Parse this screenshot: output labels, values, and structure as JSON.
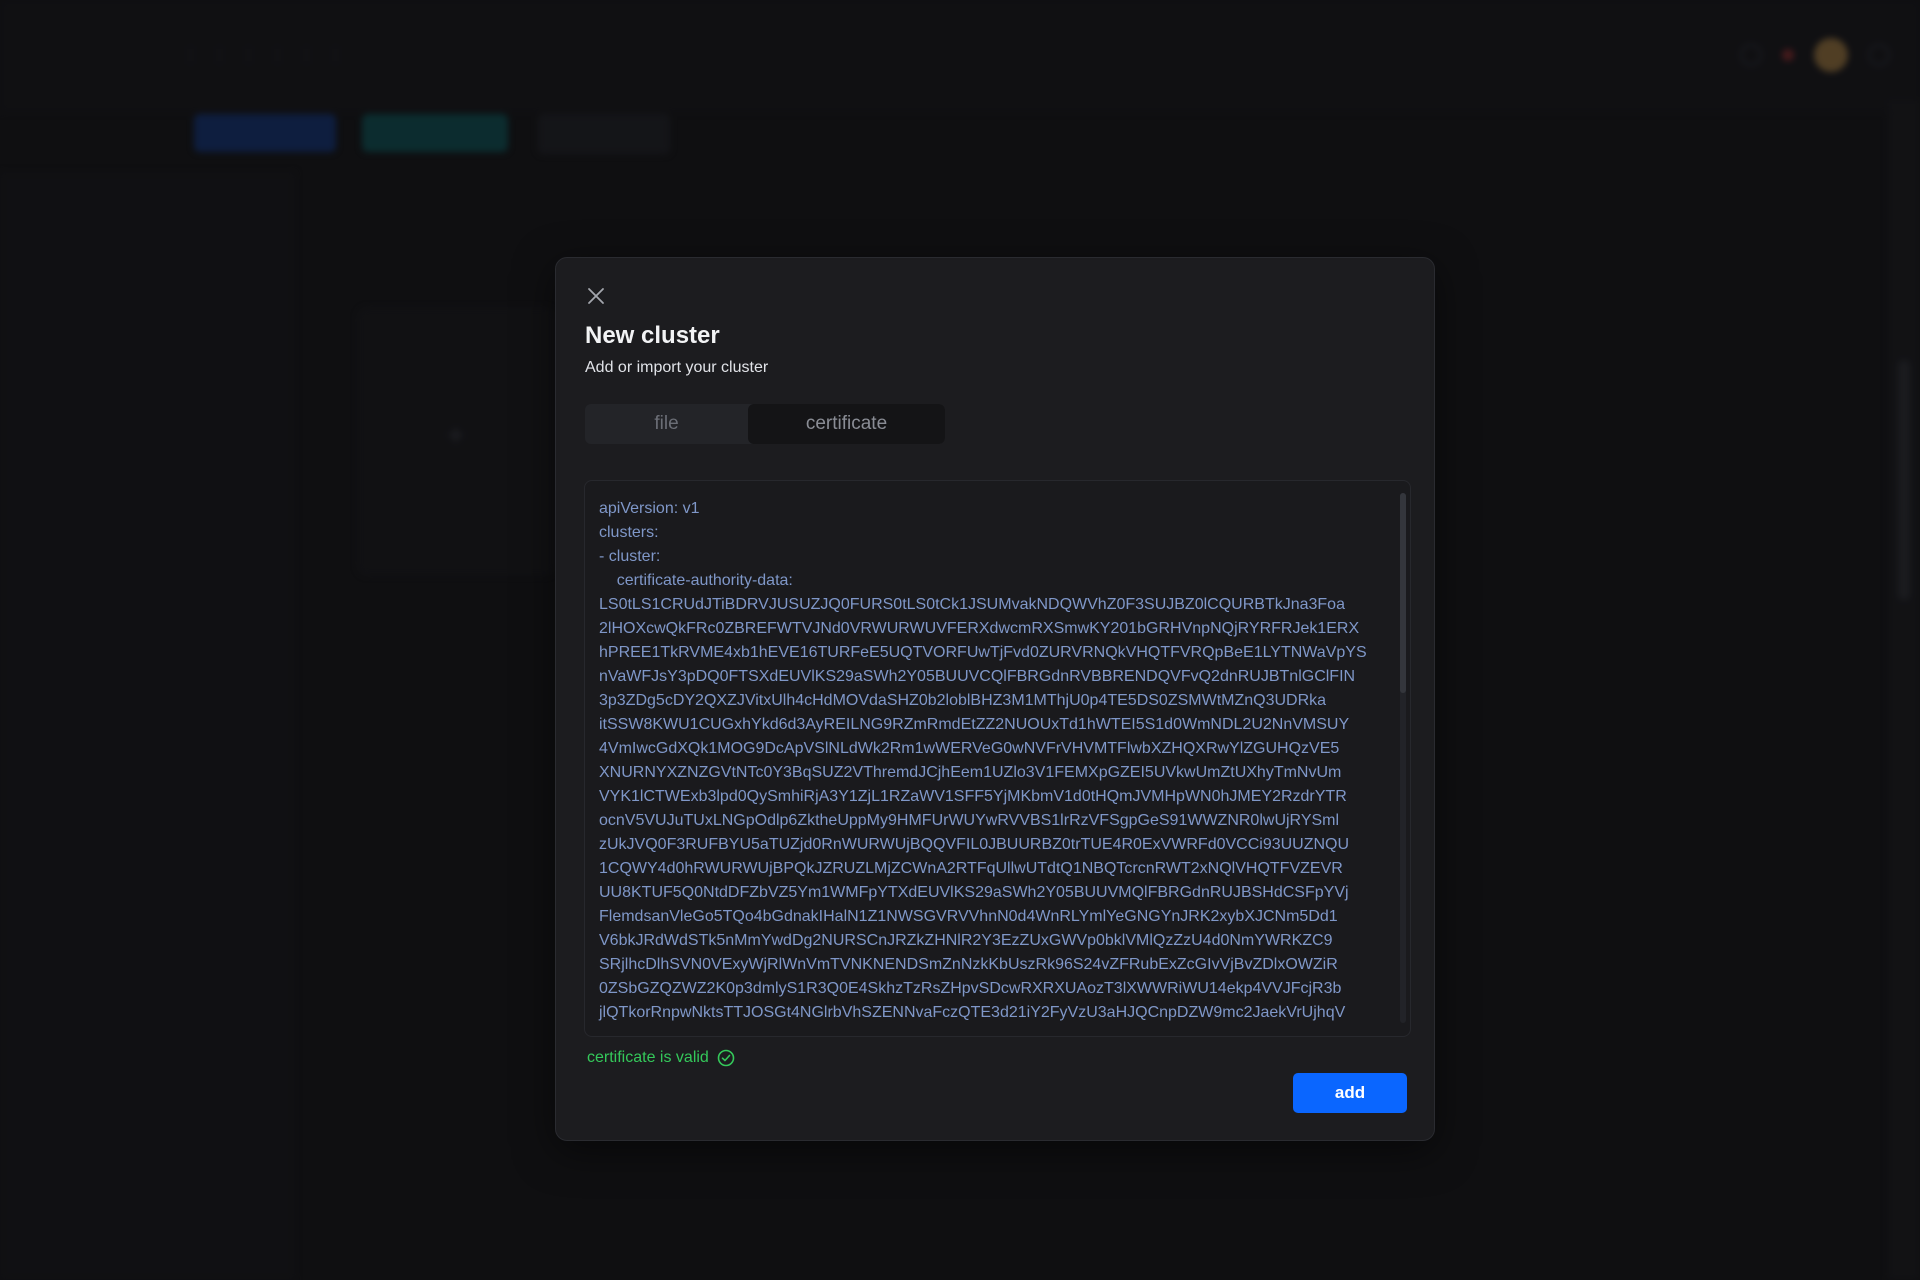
{
  "modal": {
    "title": "New cluster",
    "subtitle": "Add or import your cluster",
    "tabs": [
      {
        "label": "file",
        "active": false
      },
      {
        "label": "certificate",
        "active": true
      }
    ],
    "editor": {
      "lines": [
        "apiVersion: v1",
        "clusters:",
        "- cluster:",
        "    certificate-authority-data:",
        "LS0tLS1CRUdJTiBDRVJUSUZJQ0FURS0tLS0tCk1JSUMvakNDQWVhZ0F3SUJBZ0lCQURBTkJna3Foa",
        "2lHOXcwQkFRc0ZBREFWTVJNd0VRWURWUVFERXdwcmRXSmwKY201bGRHVnpNQjRYRFRJek1ERX",
        "hPREE1TkRVME4xb1hEVE16TURFeE5UQTVORFUwTjFvd0ZURVRNQkVHQTFVRQpBeE1LYTNWaVpYS",
        "nVaWFJsY3pDQ0FTSXdEUVlKS29aSWh2Y05BUUVCQlFBRGdnRVBBRENDQVFvQ2dnRUJBTnlGClFIN",
        "3p3ZDg5cDY2QXZJVitxUlh4cHdMOVdaSHZ0b2loblBHZ3M1MThjU0p4TE5DS0ZSMWtMZnQ3UDRka",
        "itSSW8KWU1CUGxhYkd6d3AyREILNG9RZmRmdEtZZ2NUOUxTd1hWTEI5S1d0WmNDL2U2NnVMSUY",
        "4VmIwcGdXQk1MOG9DcApVSlNLdWk2Rm1wWERVeG0wNVFrVHVMTFlwbXZHQXRwYlZGUHQzVE5",
        "XNURNYXZNZGVtNTc0Y3BqSUZ2VThremdJCjhEem1UZlo3V1FEMXpGZEI5UVkwUmZtUXhyTmNvUm",
        "VYK1lCTWExb3lpd0QySmhiRjA3Y1ZjL1RZaWV1SFF5YjMKbmV1d0tHQmJVMHpWN0hJMEY2RzdrYTR",
        "ocnV5VUJuTUxLNGpOdlp6ZktheUppMy9HMFUrWUYwRVVBS1lrRzVFSgpGeS91WWZNR0lwUjRYSml",
        "zUkJVQ0F3RUFBYU5aTUZjd0RnWURWUjBQQVFIL0JBUURBZ0trTUE4R0ExVWRFd0VCCi93UUZNQU",
        "1CQWY4d0hRWURWUjBPQkJZRUZLMjZCWnA2RTFqUllwUTdtQ1NBQTcrcnRWT2xNQlVHQTFVZEVR",
        "UU8KTUF5Q0NtdDFZbVZ5Ym1WMFpYTXdEUVlKS29aSWh2Y05BUUVMQlFBRGdnRUJBSHdCSFpYVj",
        "FlemdsanVleGo5TQo4bGdnakIHalN1Z1NWSGVRVVhnN0d4WnRLYmlYeGNGYnJRK2xybXJCNm5Dd1",
        "V6bkJRdWdSTk5nMmYwdDg2NURSCnJRZkZHNlR2Y3EzZUxGWVp0bklVMlQzZzU4d0NmYWRKZC9",
        "SRjlhcDlhSVN0VExyWjRlWnVmTVNKNENDSmZnNzkKbUszRk96S24vZFRubExZcGIvVjBvZDlxOWZiR",
        "0ZSbGZQZWZ2K0p3dmlyS1R3Q0E4SkhzTzRsZHpvSDcwRXRXUAozT3lXWWRiWU14ekp4VVJFcjR3b",
        "jlQTkorRnpwNktsTTJOSGt4NGlrbVhSZENNvaFczQTE3d21iY2FyVzU3aHJQCnpDZW9mc2JaekVrUjhqV"
      ]
    },
    "status": {
      "text": "certificate is valid",
      "color": "#34c85a",
      "icon": "check-circle-icon"
    },
    "add_label": "add",
    "accent": "#0a66ff"
  }
}
